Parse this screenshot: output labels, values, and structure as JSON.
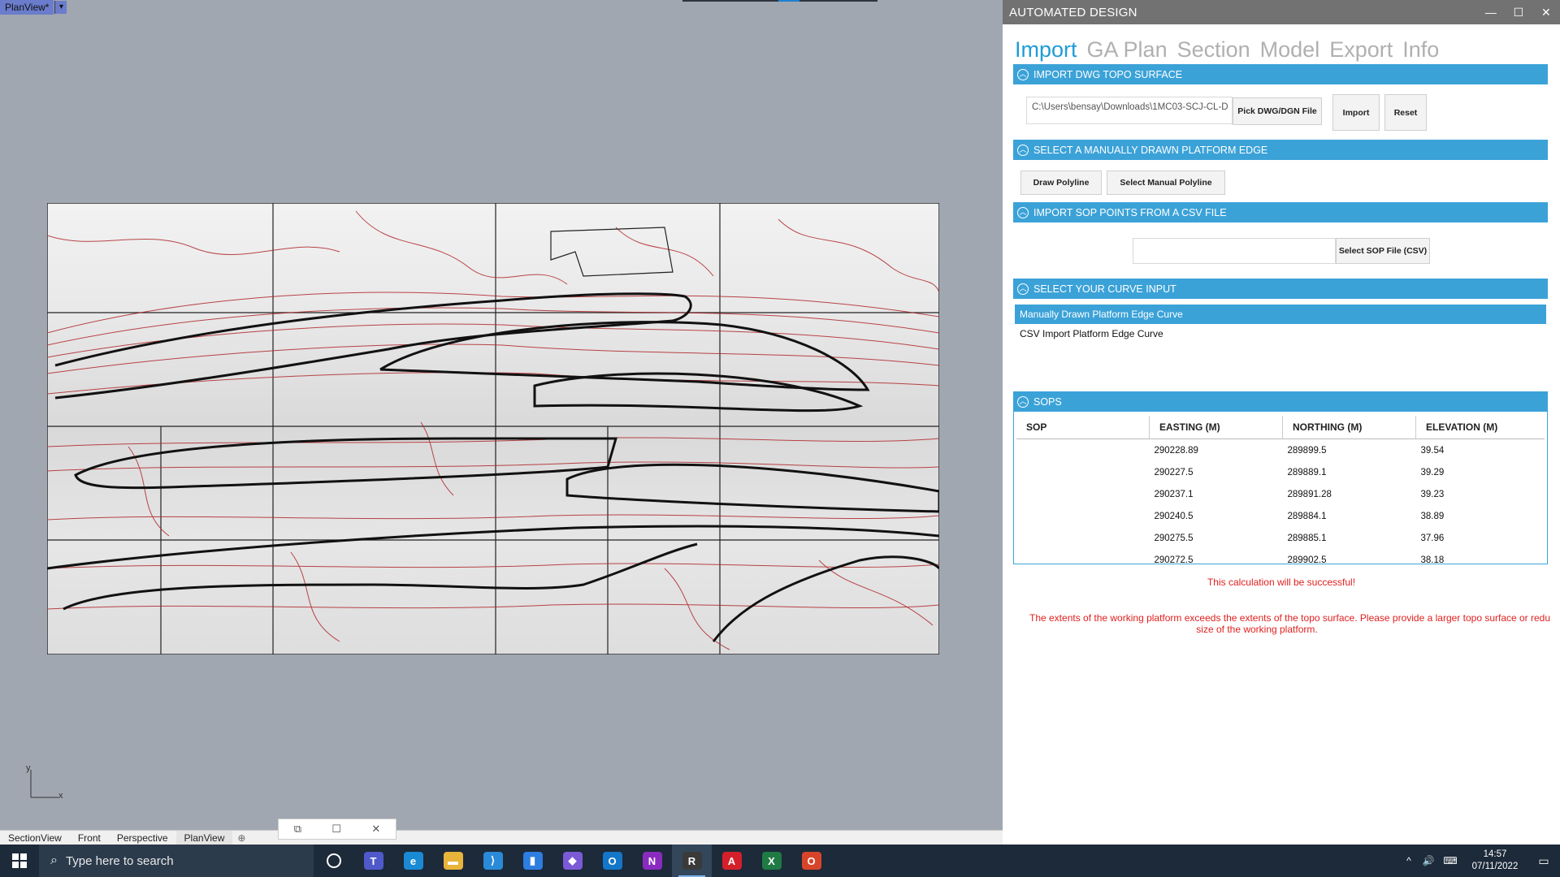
{
  "viewport": {
    "tab_label": "PlanView*",
    "tab_menu": "▾",
    "axis_y": "y",
    "axis_x": "x",
    "view_tabs": [
      "SectionView",
      "Front",
      "Perspective",
      "PlanView"
    ],
    "add_tab": "⊕"
  },
  "panel": {
    "title": "AUTOMATED DESIGN",
    "window_controls": [
      "—",
      "☐",
      "✕"
    ],
    "nav": [
      "Import",
      "GA Plan",
      "Section",
      "Model",
      "Export",
      "Info"
    ],
    "sections": {
      "import_dwg": {
        "header": "IMPORT DWG TOPO SURFACE",
        "path_value": "C:\\Users\\bensay\\Downloads\\1MC03-SCJ-CL-D",
        "pick_button": "Pick DWG/DGN File",
        "import_button": "Import",
        "reset_button": "Reset"
      },
      "platform_edge": {
        "header": "SELECT A MANUALLY DRAWN PLATFORM EDGE",
        "draw_button": "Draw Polyline",
        "select_button": "Select Manual Polyline"
      },
      "sop_csv": {
        "header": "IMPORT SOP POINTS FROM A CSV FILE",
        "file_value": "",
        "select_button": "Select SOP File (CSV)"
      },
      "curve_input": {
        "header": "SELECT YOUR CURVE INPUT",
        "items": [
          "Manually Drawn Platform Edge Curve",
          "CSV Import Platform Edge Curve"
        ]
      },
      "sops": {
        "header": "SOPS",
        "columns": [
          "SOP",
          "EASTING (M)",
          "NORTHING (M)",
          "ELEVATION (M)"
        ],
        "rows": [
          [
            "",
            "290228.89",
            "289899.5",
            "39.54"
          ],
          [
            "",
            "290227.5",
            "289889.1",
            "39.29"
          ],
          [
            "",
            "290237.1",
            "289891.28",
            "39.23"
          ],
          [
            "",
            "290240.5",
            "289884.1",
            "38.89"
          ],
          [
            "",
            "290275.5",
            "289885.1",
            "37.96"
          ],
          [
            "",
            "290272.5",
            "289902.5",
            "38.18"
          ]
        ]
      }
    },
    "messages": {
      "success": "This calculation will be successful!",
      "warning_line1": "The extents of the working platform exceeds the extents of the topo surface. Please provide a larger topo surface or redu",
      "warning_line2": "size of the working platform."
    }
  },
  "taskbar": {
    "search_placeholder": "Type here to search",
    "time": "14:57",
    "date": "07/11/2022",
    "apps": [
      {
        "name": "task-view",
        "glyph": "○",
        "color": "#1c2a3a"
      },
      {
        "name": "teams",
        "glyph": "T",
        "color": "#5059c9"
      },
      {
        "name": "edge",
        "glyph": "e",
        "color": "#1a8ad4"
      },
      {
        "name": "file-explorer",
        "glyph": "▬",
        "color": "#e8b43a"
      },
      {
        "name": "vscode",
        "glyph": "⟩",
        "color": "#2a8ad8"
      },
      {
        "name": "app-blue",
        "glyph": "▮",
        "color": "#2e7de0"
      },
      {
        "name": "obsidian",
        "glyph": "◆",
        "color": "#7b5ad6"
      },
      {
        "name": "outlook",
        "glyph": "O",
        "color": "#1476c8"
      },
      {
        "name": "onenote",
        "glyph": "N",
        "color": "#8a2bbf"
      },
      {
        "name": "rhino",
        "glyph": "R",
        "color": "#3a3a3a"
      },
      {
        "name": "autocad",
        "glyph": "A",
        "color": "#d4202a"
      },
      {
        "name": "excel",
        "glyph": "X",
        "color": "#1f7a44"
      },
      {
        "name": "office",
        "glyph": "O",
        "color": "#d8442a"
      }
    ],
    "tray_icons": [
      "^",
      "🔊",
      "⌨"
    ],
    "notification": "▭"
  }
}
